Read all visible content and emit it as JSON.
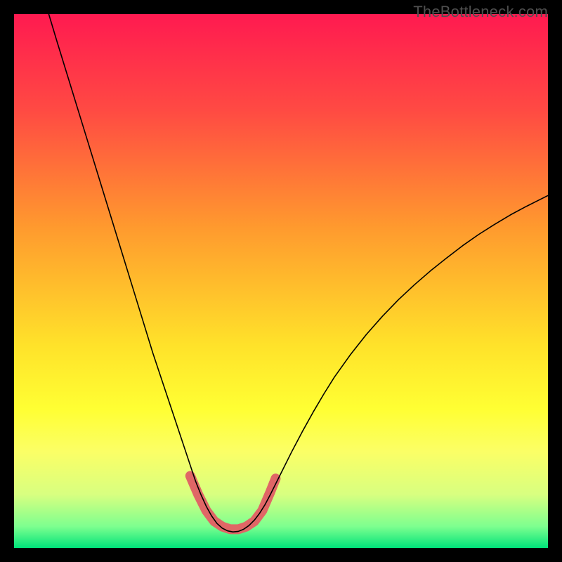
{
  "watermark": "TheBottleneck.com",
  "chart_data": {
    "type": "line",
    "title": "",
    "xlabel": "",
    "ylabel": "",
    "xlim": [
      0,
      100
    ],
    "ylim": [
      0,
      100
    ],
    "grid": false,
    "legend": false,
    "gradient_stops": [
      {
        "offset": 0,
        "color": "#ff1a50"
      },
      {
        "offset": 0.18,
        "color": "#ff4a43"
      },
      {
        "offset": 0.4,
        "color": "#ff9a2e"
      },
      {
        "offset": 0.62,
        "color": "#ffe22a"
      },
      {
        "offset": 0.74,
        "color": "#ffff33"
      },
      {
        "offset": 0.82,
        "color": "#fbff66"
      },
      {
        "offset": 0.9,
        "color": "#d8ff80"
      },
      {
        "offset": 0.96,
        "color": "#7dff8f"
      },
      {
        "offset": 1.0,
        "color": "#00e37a"
      }
    ],
    "highlight": {
      "color": "#e06666",
      "width": 14,
      "x_range": [
        33,
        49
      ],
      "points": [
        {
          "x": 33.0,
          "y": 13.5
        },
        {
          "x": 34.5,
          "y": 10.0
        },
        {
          "x": 36.0,
          "y": 7.0
        },
        {
          "x": 37.5,
          "y": 5.0
        },
        {
          "x": 39.0,
          "y": 4.0
        },
        {
          "x": 40.5,
          "y": 3.5
        },
        {
          "x": 42.0,
          "y": 3.5
        },
        {
          "x": 43.5,
          "y": 4.0
        },
        {
          "x": 45.0,
          "y": 5.0
        },
        {
          "x": 46.5,
          "y": 7.0
        },
        {
          "x": 48.0,
          "y": 10.5
        },
        {
          "x": 49.0,
          "y": 13.0
        }
      ]
    },
    "series": [
      {
        "name": "bottleneck-curve",
        "color": "#000000",
        "width": 1.6,
        "points": [
          {
            "x": 6.5,
            "y": 100.0
          },
          {
            "x": 8.0,
            "y": 95.0
          },
          {
            "x": 10.0,
            "y": 88.5
          },
          {
            "x": 12.0,
            "y": 82.0
          },
          {
            "x": 14.0,
            "y": 75.5
          },
          {
            "x": 16.0,
            "y": 69.0
          },
          {
            "x": 18.0,
            "y": 62.5
          },
          {
            "x": 20.0,
            "y": 56.0
          },
          {
            "x": 22.0,
            "y": 49.5
          },
          {
            "x": 24.0,
            "y": 43.0
          },
          {
            "x": 26.0,
            "y": 36.5
          },
          {
            "x": 28.0,
            "y": 30.5
          },
          {
            "x": 30.0,
            "y": 24.5
          },
          {
            "x": 32.0,
            "y": 18.5
          },
          {
            "x": 33.0,
            "y": 15.5
          },
          {
            "x": 34.0,
            "y": 12.5
          },
          {
            "x": 35.0,
            "y": 10.0
          },
          {
            "x": 36.0,
            "y": 7.8
          },
          {
            "x": 37.0,
            "y": 6.0
          },
          {
            "x": 38.0,
            "y": 4.6
          },
          {
            "x": 39.0,
            "y": 3.7
          },
          {
            "x": 40.0,
            "y": 3.2
          },
          {
            "x": 41.0,
            "y": 3.0
          },
          {
            "x": 42.0,
            "y": 3.1
          },
          {
            "x": 43.0,
            "y": 3.5
          },
          {
            "x": 44.0,
            "y": 4.2
          },
          {
            "x": 45.0,
            "y": 5.2
          },
          {
            "x": 46.0,
            "y": 6.5
          },
          {
            "x": 47.0,
            "y": 8.1
          },
          {
            "x": 48.0,
            "y": 10.0
          },
          {
            "x": 49.0,
            "y": 12.0
          },
          {
            "x": 50.0,
            "y": 14.0
          },
          {
            "x": 52.0,
            "y": 18.0
          },
          {
            "x": 54.0,
            "y": 21.8
          },
          {
            "x": 56.0,
            "y": 25.4
          },
          {
            "x": 58.0,
            "y": 28.8
          },
          {
            "x": 60.0,
            "y": 32.0
          },
          {
            "x": 63.0,
            "y": 36.2
          },
          {
            "x": 66.0,
            "y": 40.0
          },
          {
            "x": 69.0,
            "y": 43.4
          },
          {
            "x": 72.0,
            "y": 46.5
          },
          {
            "x": 75.0,
            "y": 49.3
          },
          {
            "x": 78.0,
            "y": 51.9
          },
          {
            "x": 81.0,
            "y": 54.3
          },
          {
            "x": 84.0,
            "y": 56.6
          },
          {
            "x": 87.0,
            "y": 58.7
          },
          {
            "x": 90.0,
            "y": 60.6
          },
          {
            "x": 93.0,
            "y": 62.4
          },
          {
            "x": 96.0,
            "y": 64.0
          },
          {
            "x": 100.0,
            "y": 66.0
          }
        ]
      }
    ]
  }
}
